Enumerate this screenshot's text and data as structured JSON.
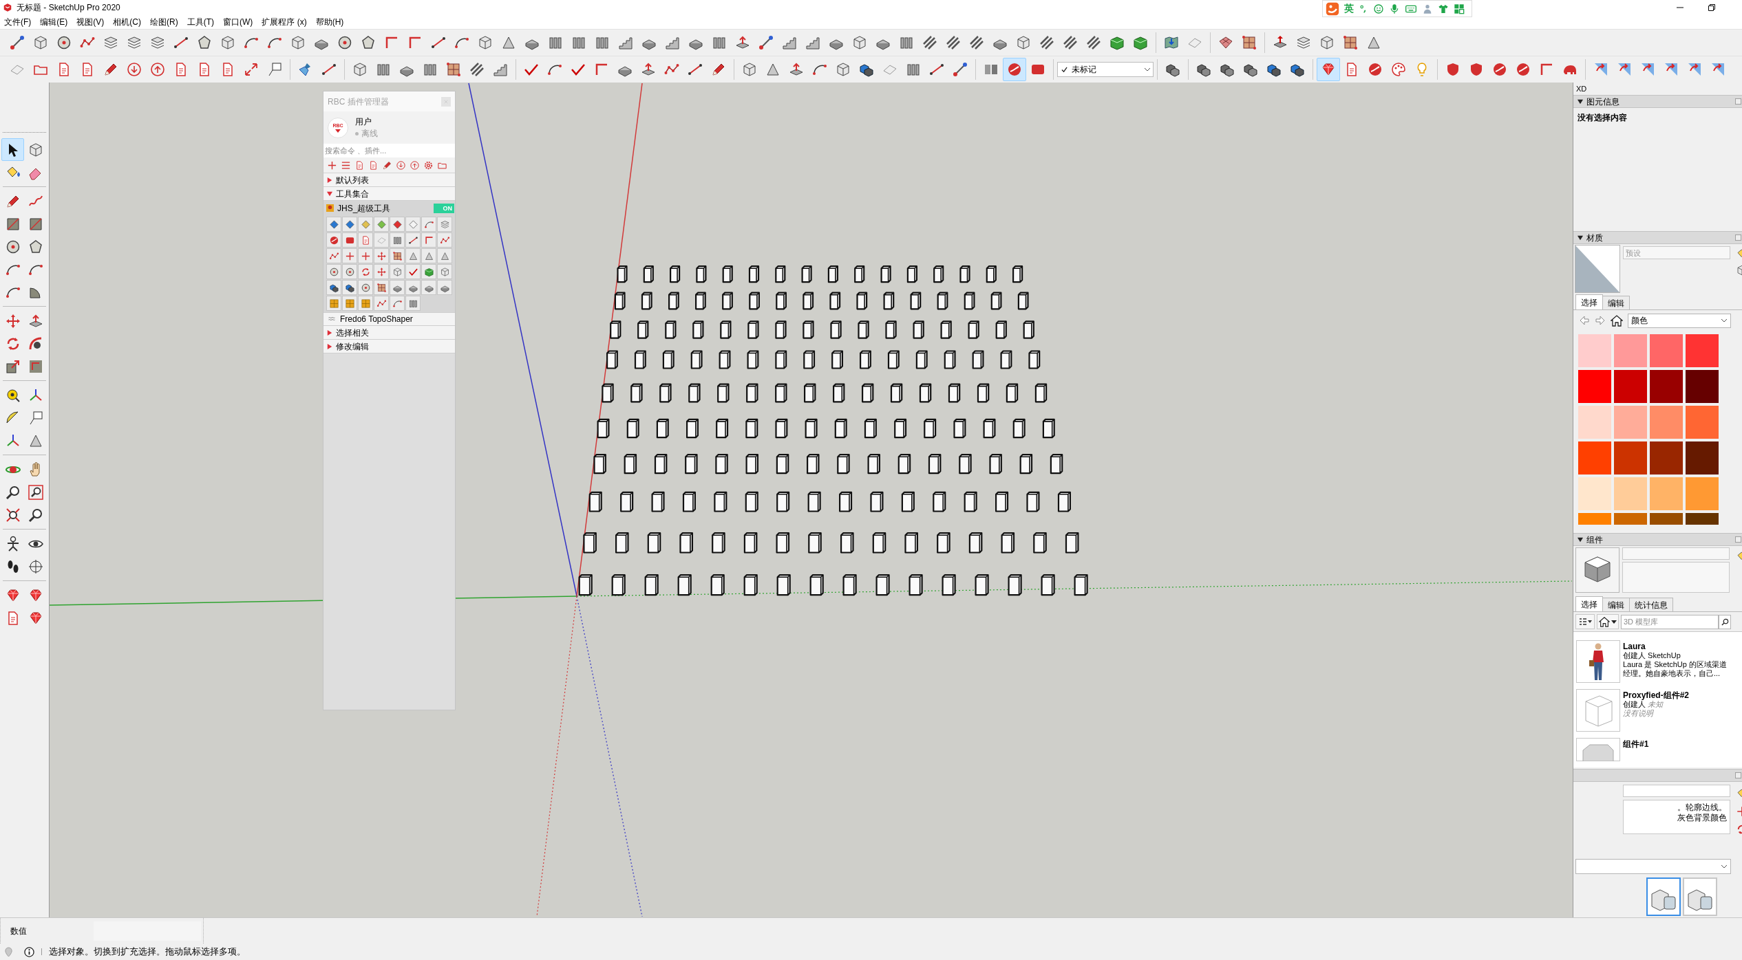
{
  "window": {
    "title": "无标题 - SketchUp Pro 2020"
  },
  "input_method_bar": {
    "mode": "英"
  },
  "menu_bar": [
    "文件(F)",
    "编辑(E)",
    "视图(V)",
    "相机(C)",
    "绘图(R)",
    "工具(T)",
    "窗口(W)",
    "扩展程序 (x)",
    "帮助(H)"
  ],
  "toolbar_row_1": {
    "groups": [
      {
        "buttons": [
          {
            "selected": false
          },
          {
            "selected": false
          },
          {
            "selected": false
          },
          {
            "selected": false
          },
          {
            "selected": false
          },
          {
            "selected": false
          },
          {
            "selected": false
          },
          {
            "selected": false
          },
          {
            "selected": false
          },
          {
            "selected": false
          },
          {
            "selected": false
          },
          {
            "selected": false
          },
          {
            "selected": false
          },
          {
            "selected": false
          },
          {
            "selected": false
          },
          {
            "selected": false
          },
          {
            "selected": false
          },
          {
            "selected": false
          },
          {
            "selected": false
          },
          {
            "selected": false
          },
          {
            "selected": false
          },
          {
            "selected": false
          },
          {
            "selected": false
          },
          {
            "selected": false
          },
          {
            "selected": false
          },
          {
            "selected": false
          },
          {
            "selected": false
          },
          {
            "selected": false
          },
          {
            "selected": false
          },
          {
            "selected": false
          },
          {
            "selected": false
          },
          {
            "selected": false
          },
          {
            "selected": false
          },
          {
            "selected": false
          },
          {
            "selected": false
          },
          {
            "selected": false
          },
          {
            "selected": false
          },
          {
            "selected": false
          },
          {
            "selected": false
          },
          {
            "selected": false
          },
          {
            "selected": false
          },
          {
            "selected": false
          },
          {
            "selected": false
          },
          {
            "selected": false
          },
          {
            "selected": false
          },
          {
            "selected": false
          },
          {
            "selected": false
          },
          {
            "selected": false
          },
          {
            "selected": false
          }
        ]
      },
      {
        "buttons": [
          {
            "selected": false
          },
          {
            "selected": false
          }
        ]
      },
      {
        "buttons": [
          {
            "selected": false
          },
          {
            "selected": false
          }
        ]
      },
      {
        "buttons": [
          {
            "selected": false
          },
          {
            "selected": false
          },
          {
            "selected": false
          },
          {
            "selected": false
          },
          {
            "selected": false
          }
        ]
      }
    ]
  },
  "toolbar_row_2": {
    "groups_left": [
      {
        "buttons": [
          {
            "selected": false
          },
          {
            "selected": false
          },
          {
            "selected": false
          },
          {
            "selected": false
          },
          {
            "selected": false
          },
          {
            "selected": false
          },
          {
            "selected": false
          },
          {
            "selected": false
          },
          {
            "selected": false
          },
          {
            "selected": false
          },
          {
            "selected": false
          },
          {
            "selected": false
          }
        ]
      },
      {
        "buttons": [
          {
            "selected": false
          },
          {
            "selected": false
          }
        ]
      },
      {
        "buttons": [
          {
            "selected": false
          },
          {
            "selected": false
          },
          {
            "selected": false
          },
          {
            "selected": false
          },
          {
            "selected": false
          },
          {
            "selected": false
          },
          {
            "selected": false
          }
        ]
      },
      {
        "buttons": [
          {
            "selected": false
          },
          {
            "selected": false
          },
          {
            "selected": false
          },
          {
            "selected": false
          },
          {
            "selected": false
          },
          {
            "selected": false
          },
          {
            "selected": false
          },
          {
            "selected": false
          },
          {
            "selected": false
          }
        ]
      },
      {
        "buttons": [
          {
            "selected": false
          },
          {
            "selected": false
          },
          {
            "selected": false
          },
          {
            "selected": false
          },
          {
            "selected": false
          },
          {
            "selected": false
          },
          {
            "selected": false
          },
          {
            "selected": false
          },
          {
            "selected": false
          },
          {
            "selected": false
          }
        ]
      },
      {
        "buttons": [
          {
            "selected": false
          },
          {
            "selected": true
          },
          {
            "selected": false
          }
        ]
      }
    ],
    "tag_dropdown": {
      "checked": true,
      "value": "未标记"
    },
    "groups_right": [
      {
        "buttons": [
          {
            "selected": false
          }
        ]
      },
      {
        "buttons": [
          {
            "selected": false
          },
          {
            "selected": false
          },
          {
            "selected": false
          },
          {
            "selected": false
          },
          {
            "selected": false
          }
        ]
      },
      {
        "buttons": [
          {
            "selected": true
          },
          {
            "selected": false
          },
          {
            "selected": false
          },
          {
            "selected": false
          },
          {
            "selected": false
          }
        ]
      },
      {
        "buttons": [
          {
            "selected": false
          },
          {
            "selected": false
          },
          {
            "selected": false
          },
          {
            "selected": false
          },
          {
            "selected": false
          },
          {
            "selected": false
          }
        ]
      },
      {
        "buttons": [
          {
            "selected": false
          },
          {
            "selected": false
          },
          {
            "selected": false
          },
          {
            "selected": false
          },
          {
            "selected": false
          },
          {
            "selected": false
          }
        ]
      }
    ]
  },
  "left_toolbar": {
    "groups": [
      {
        "buttons": [
          {
            "selected": true
          },
          {
            "selected": false
          },
          {
            "selected": false
          },
          {
            "selected": false
          }
        ]
      },
      {
        "buttons": [
          {
            "selected": false
          },
          {
            "selected": false
          },
          {
            "selected": false
          },
          {
            "selected": false
          },
          {
            "selected": false
          },
          {
            "selected": false
          },
          {
            "selected": false
          },
          {
            "selected": false
          },
          {
            "selected": false
          },
          {
            "selected": false
          }
        ]
      },
      {
        "buttons": [
          {
            "selected": false
          },
          {
            "selected": false
          },
          {
            "selected": false
          },
          {
            "selected": false
          },
          {
            "selected": false
          },
          {
            "selected": false
          }
        ]
      },
      {
        "buttons": [
          {
            "selected": false
          },
          {
            "selected": false
          },
          {
            "selected": false
          },
          {
            "selected": false
          },
          {
            "selected": false
          },
          {
            "selected": false
          }
        ]
      },
      {
        "buttons": [
          {
            "selected": false
          },
          {
            "selected": false
          },
          {
            "selected": false
          },
          {
            "selected": false
          },
          {
            "selected": false
          },
          {
            "selected": false
          }
        ]
      },
      {
        "buttons": [
          {
            "selected": false
          },
          {
            "selected": false
          },
          {
            "selected": false
          },
          {
            "selected": false
          }
        ]
      },
      {
        "buttons": [
          {
            "selected": false
          },
          {
            "selected": false
          },
          {
            "selected": false
          },
          {
            "selected": false
          }
        ]
      }
    ]
  },
  "plugin_panel": {
    "title": "RBC 插件管理器",
    "logo_text": "RBC",
    "user": {
      "name": "用户",
      "status": "离线",
      "online": false
    },
    "search": {
      "placeholder": "搜索命令 、插件..."
    },
    "tree": [
      {
        "label": "默认列表",
        "expanded": false
      },
      {
        "label": "工具集合",
        "expanded": true,
        "children": [
          {
            "kind": "toolset",
            "label": "JHS_超级工具",
            "on": true,
            "toggle_text": "ON"
          },
          {
            "kind": "plugin",
            "label": "Fredo6 TopoShaper"
          }
        ]
      },
      {
        "label": "选择相关",
        "expanded": false
      },
      {
        "label": "修改编辑",
        "expanded": false
      }
    ]
  },
  "tray": {
    "title": "XD",
    "entity_info": {
      "title": "图元信息",
      "expanded": true,
      "message": "没有选择内容"
    },
    "materials": {
      "title": "材质",
      "expanded": true,
      "name_field": {
        "placeholder": "预设"
      },
      "tabs": [
        {
          "label": "选择",
          "selected": true
        },
        {
          "label": "编辑",
          "selected": false
        }
      ],
      "library": "颜色",
      "swatches": [
        {
          "color": "#ffcccc"
        },
        {
          "color": "#ff9999"
        },
        {
          "color": "#ff6666"
        },
        {
          "color": "#ff3333"
        },
        {
          "color": "#ff0000"
        },
        {
          "color": "#cc0000"
        },
        {
          "color": "#990000"
        },
        {
          "color": "#660000"
        },
        {
          "color": "#ffd9cc"
        },
        {
          "color": "#ffac99"
        },
        {
          "color": "#ff8c66"
        },
        {
          "color": "#ff6633"
        },
        {
          "color": "#ff4000"
        },
        {
          "color": "#cc3300"
        },
        {
          "color": "#992600"
        },
        {
          "color": "#661a00"
        },
        {
          "color": "#ffe6cc"
        },
        {
          "color": "#ffcc99"
        },
        {
          "color": "#ffb366"
        },
        {
          "color": "#ff9933"
        },
        {
          "color": "#ff8000"
        },
        {
          "color": "#cc6600"
        },
        {
          "color": "#994d00"
        },
        {
          "color": "#663300"
        }
      ]
    },
    "components": {
      "title": "组件",
      "expanded": true,
      "tabs": [
        {
          "label": "选择",
          "selected": true
        },
        {
          "label": "编辑",
          "selected": false
        },
        {
          "label": "统计信息",
          "selected": false
        }
      ],
      "search": {
        "placeholder": "3D 模型库"
      },
      "items": [
        {
          "kind": "figure",
          "name": "Laura",
          "author": "创建人 SketchUp",
          "description": "Laura 是 SketchUp 的区域渠道经理。她自豪地表示，自己...",
          "described": true
        },
        {
          "kind": "wireframe",
          "name": "Proxyfied-组件#2",
          "author": "创建人 *未知*",
          "description": "没有说明",
          "described": false
        },
        {
          "kind": "block",
          "name": "组件#1"
        }
      ]
    },
    "styles": {
      "description": [
        "。轮廓边线。",
        "灰色背景颜色"
      ],
      "thumbnails": [
        {
          "selected": true
        },
        {
          "selected": false
        }
      ]
    }
  },
  "measurements": {
    "label": "数值"
  },
  "status_bar": {
    "message": "选择对象。切换到扩充选择。拖动鼠标选择多项。"
  }
}
